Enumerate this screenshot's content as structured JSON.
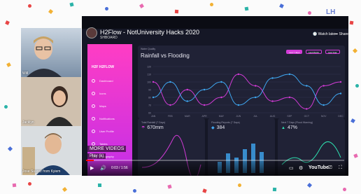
{
  "brand": "LH",
  "participants": [
    {
      "name": "Will"
    },
    {
      "name": "Jacklyn"
    },
    {
      "name": "Jose Suarez from Kyiem"
    }
  ],
  "video": {
    "title": "H2Flow - NotUniversity Hacks 2020",
    "channel_sub": "SHBOARD",
    "watch_later_label": "Watch later",
    "share_label": "Share",
    "more_videos_label": "MORE VIDEOS",
    "play_hint": "Play (k)",
    "time": "0:03 / 1:56",
    "progress": 0.03,
    "youtube_label": "YouTube"
  },
  "dashboard": {
    "sidebar_logo": "H2F  H2FLOW",
    "sidebar_items": [
      "Dashboard",
      "Icons",
      "Maps",
      "Notifications",
      "User Profile",
      "Tables",
      "Typography"
    ],
    "chart_subtitle": "Water Quality",
    "chart_title": "Rainfall vs Flooding",
    "pills": [
      "Last 7 days",
      "Last Month",
      "Last Year"
    ],
    "cards": [
      {
        "label": "Total Rainfall (7 Days)",
        "value": "670mm",
        "icon": "umbrella-icon"
      },
      {
        "label": "Flooding Reports (7 Days)",
        "value": "384",
        "icon": "bell-icon"
      },
      {
        "label": "Next 7 Days (Flood Warning)",
        "value": "47%",
        "icon": "warning-icon"
      }
    ]
  },
  "chart_data": {
    "type": "line",
    "categories": [
      "JAN",
      "FEB",
      "MAR",
      "APR",
      "MAY",
      "JUN",
      "JUL",
      "AUG",
      "SEP",
      "OCT",
      "NOV",
      "DEC"
    ],
    "series": [
      {
        "name": "",
        "values": [
          100,
          70,
          90,
          70,
          80,
          110,
          95,
          75,
          80,
          65,
          95,
          100
        ]
      },
      {
        "name": "",
        "values": [
          80,
          100,
          75,
          90,
          100,
          70,
          80,
          105,
          110,
          95,
          70,
          85
        ]
      }
    ],
    "ylim": [
      60,
      120
    ],
    "yticks": [
      60,
      70,
      80,
      90,
      100,
      110,
      120
    ],
    "colors": [
      "#d33bd7",
      "#3fa8f2"
    ]
  }
}
